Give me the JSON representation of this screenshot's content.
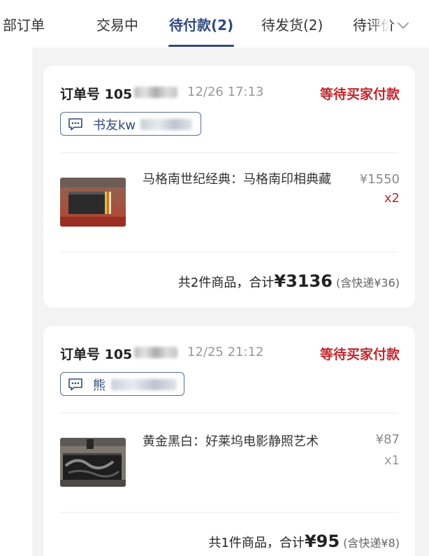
{
  "tabs": [
    {
      "label": "部订单",
      "active": false
    },
    {
      "label": "交易中",
      "active": false
    },
    {
      "label": "待付款(2)",
      "active": true
    },
    {
      "label": "待发货(2)",
      "active": false
    },
    {
      "label": "待评价",
      "active": false
    }
  ],
  "more_icon": "chevron-down-icon",
  "colors": {
    "accent": "#2f4a7d",
    "status_red": "#c0262d",
    "list_bg": "#f3f3f3"
  },
  "orders": [
    {
      "order_label": "订单号 105",
      "time": "12/26 17:13",
      "status": "等待买家付款",
      "buyer_icon": "chat-icon",
      "buyer_name": "书友kw",
      "product_title": "马格南世纪经典：马格南印相典藏",
      "price": "¥1550",
      "quantity": "x2",
      "summary_prefix": "共2件商品，合计",
      "total": "¥3136",
      "shipping": "(含快递¥36)"
    },
    {
      "order_label": "订单号 105",
      "time": "12/25 21:12",
      "status": "等待买家付款",
      "buyer_icon": "chat-icon",
      "buyer_name": "熊",
      "product_title": "黄金黑白：好莱坞电影静照艺术",
      "price": "¥87",
      "quantity": "x1",
      "summary_prefix": "共1件商品，合计",
      "total": "¥95",
      "shipping": "(含快递¥8)"
    }
  ]
}
